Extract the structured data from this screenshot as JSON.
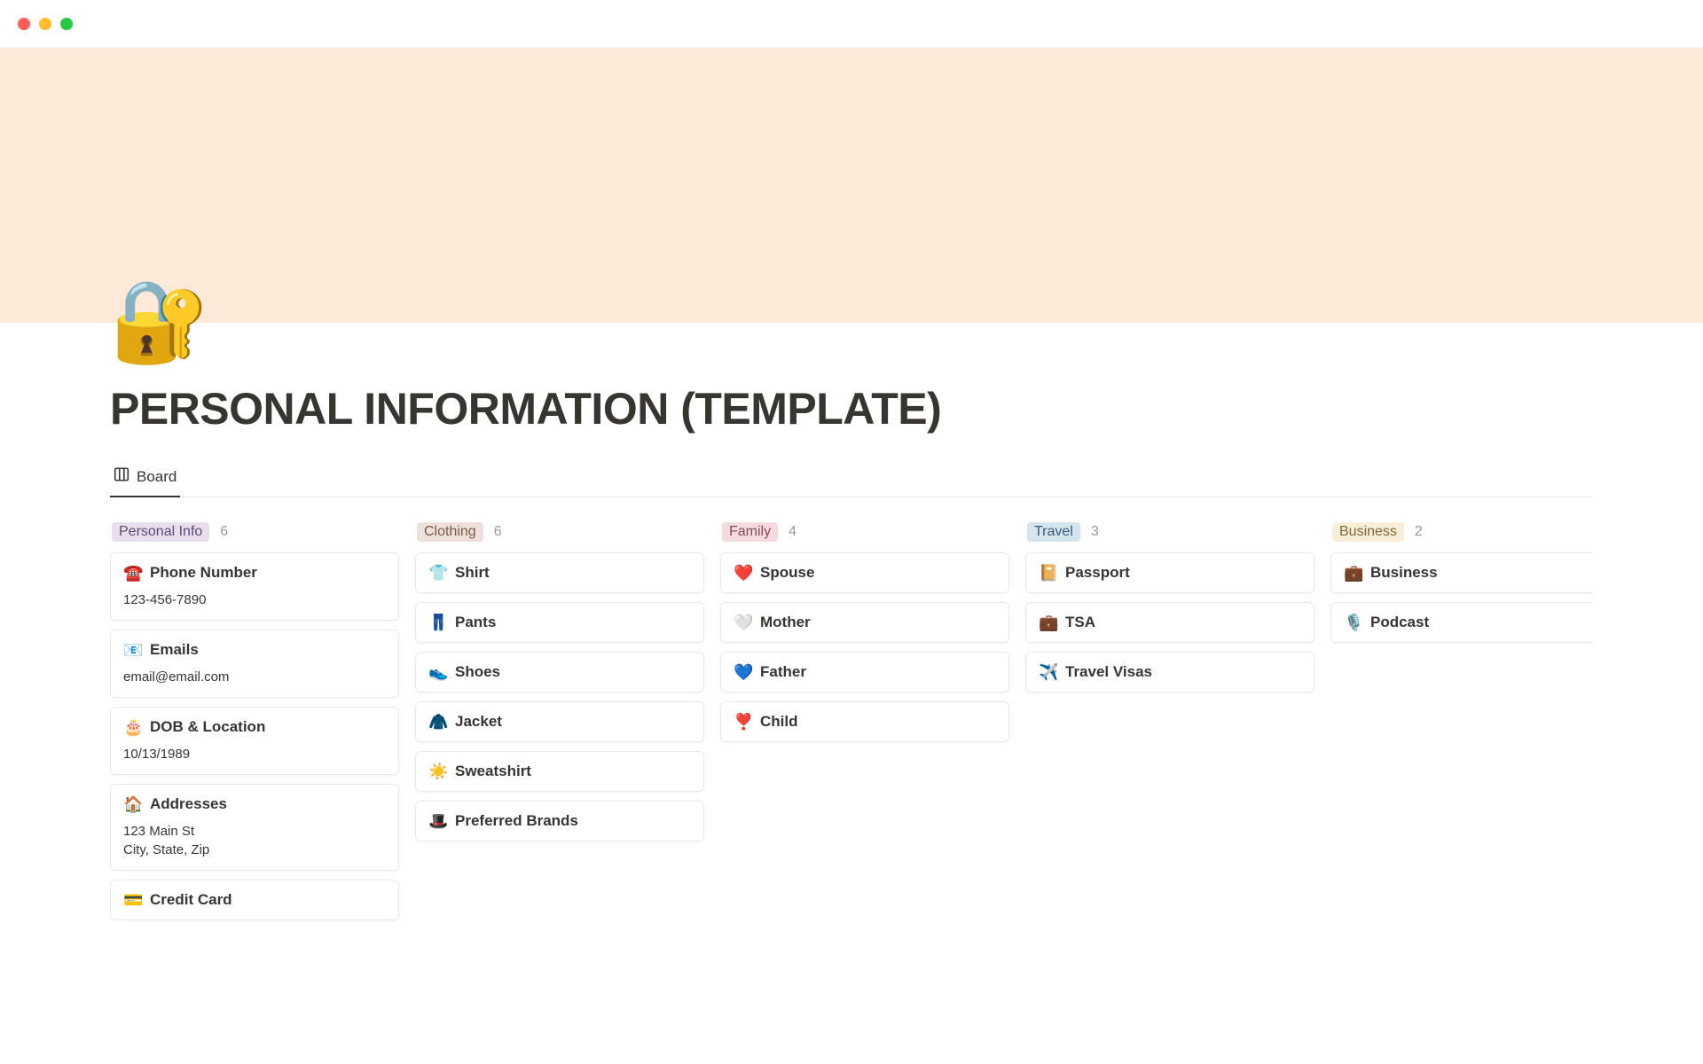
{
  "page": {
    "icon": "🔐",
    "title": "PERSONAL INFORMATION (TEMPLATE)"
  },
  "view": {
    "tab_label": "Board"
  },
  "columns": [
    {
      "tag": "Personal Info",
      "tag_class": "tag-purple",
      "count": "6",
      "cards": [
        {
          "icon": "☎️",
          "title": "Phone Number",
          "body": "123-456-7890"
        },
        {
          "icon": "📧",
          "title": "Emails",
          "body": "email@email.com"
        },
        {
          "icon": "🎂",
          "title": "DOB & Location",
          "body": "10/13/1989"
        },
        {
          "icon": "🏠",
          "title": "Addresses",
          "body": "123 Main St\nCity, State, Zip"
        },
        {
          "icon": "💳",
          "title": "Credit Card",
          "body": ""
        }
      ]
    },
    {
      "tag": "Clothing",
      "tag_class": "tag-beige",
      "count": "6",
      "cards": [
        {
          "icon": "👕",
          "title": "Shirt",
          "body": ""
        },
        {
          "icon": "👖",
          "title": "Pants",
          "body": ""
        },
        {
          "icon": "👟",
          "title": "Shoes",
          "body": ""
        },
        {
          "icon": "🧥",
          "title": "Jacket",
          "body": ""
        },
        {
          "icon": "☀️",
          "title": "Sweatshirt",
          "body": ""
        },
        {
          "icon": "🎩",
          "title": "Preferred Brands",
          "body": ""
        }
      ]
    },
    {
      "tag": "Family",
      "tag_class": "tag-pink",
      "count": "4",
      "cards": [
        {
          "icon": "❤️",
          "title": "Spouse",
          "body": ""
        },
        {
          "icon": "🤍",
          "title": "Mother",
          "body": ""
        },
        {
          "icon": "💙",
          "title": "Father",
          "body": ""
        },
        {
          "icon": "❣️",
          "title": "Child",
          "body": ""
        }
      ]
    },
    {
      "tag": "Travel",
      "tag_class": "tag-blue",
      "count": "3",
      "cards": [
        {
          "icon": "📔",
          "title": "Passport",
          "body": ""
        },
        {
          "icon": "💼",
          "title": "TSA",
          "body": ""
        },
        {
          "icon": "✈️",
          "title": "Travel Visas",
          "body": ""
        }
      ]
    },
    {
      "tag": "Business",
      "tag_class": "tag-yellow",
      "count": "2",
      "cards": [
        {
          "icon": "💼",
          "title": "Business",
          "body": ""
        },
        {
          "icon": "🎙️",
          "title": "Podcast",
          "body": ""
        }
      ]
    }
  ]
}
